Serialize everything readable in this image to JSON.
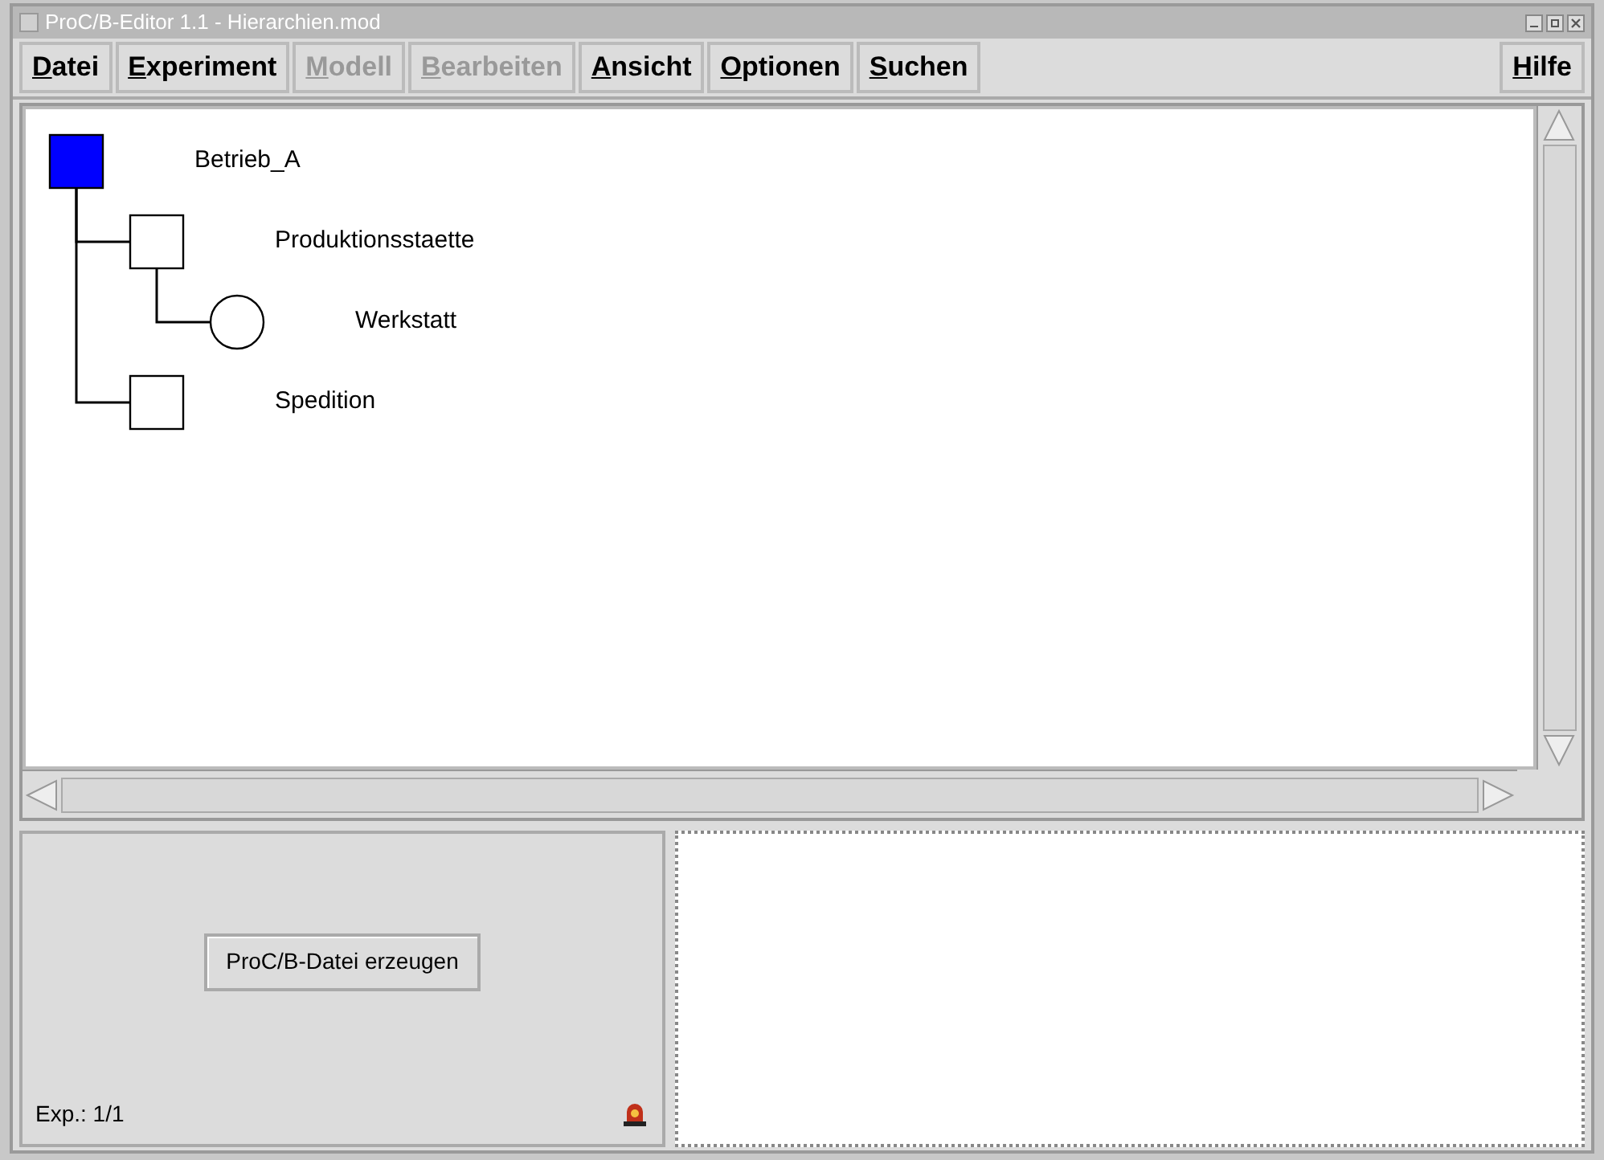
{
  "window": {
    "title": "ProC/B-Editor 1.1 - Hierarchien.mod"
  },
  "menu": [
    {
      "label": "Datei",
      "disabled": false
    },
    {
      "label": "Experiment",
      "disabled": false
    },
    {
      "label": "Modell",
      "disabled": true
    },
    {
      "label": "Bearbeiten",
      "disabled": true
    },
    {
      "label": "Ansicht",
      "disabled": false
    },
    {
      "label": "Optionen",
      "disabled": false
    },
    {
      "label": "Suchen",
      "disabled": false
    }
  ],
  "help_menu": {
    "label": "Hilfe",
    "disabled": false
  },
  "tree": [
    {
      "label": "Betrieb_A",
      "kind": "square",
      "selected": true,
      "children": [
        {
          "label": "Produktionsstaette",
          "kind": "square",
          "selected": false,
          "children": [
            {
              "label": "Werkstatt",
              "kind": "circle",
              "selected": false
            }
          ]
        },
        {
          "label": "Spedition",
          "kind": "square",
          "selected": false
        }
      ]
    }
  ],
  "generate_button": "ProC/B-Datei erzeugen",
  "status": "Exp.: 1/1"
}
